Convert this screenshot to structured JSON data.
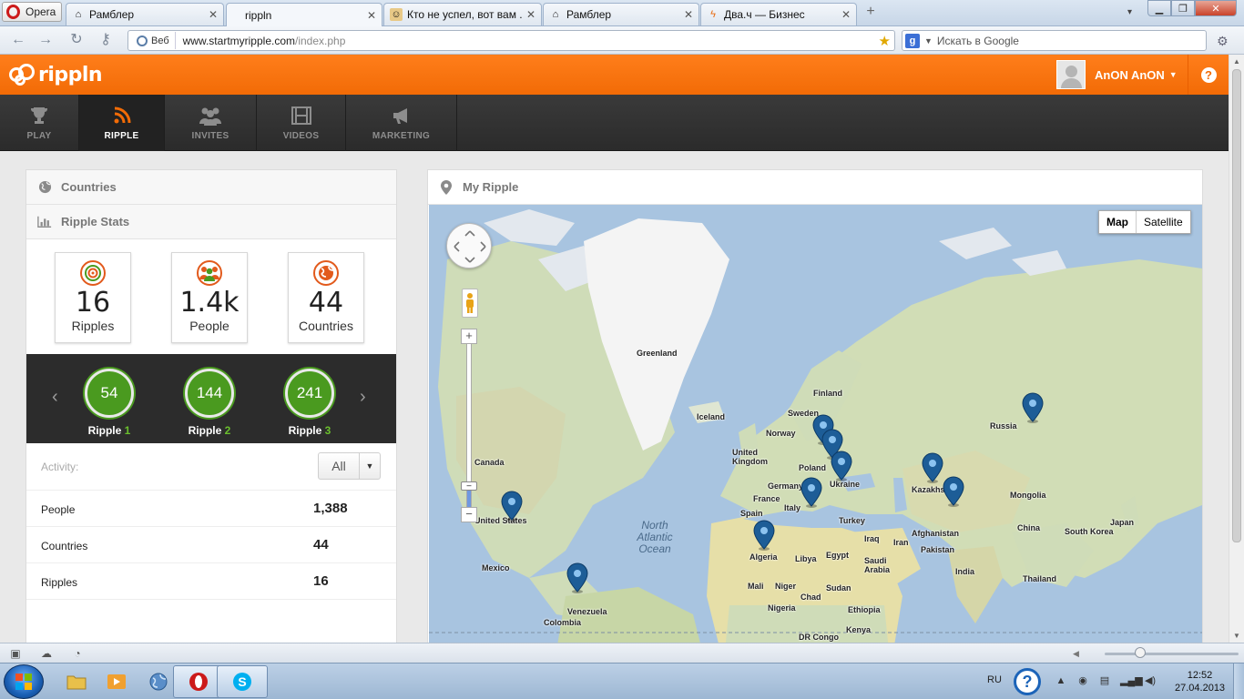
{
  "browser": {
    "menu_label": "Opera",
    "tabs": [
      {
        "label": "Рамблер",
        "fav": "home-icon"
      },
      {
        "label": "rippln",
        "fav": "none",
        "active": true
      },
      {
        "label": "Кто не успел, вот вам ...",
        "fav": "face-icon"
      },
      {
        "label": "Рамблер",
        "fav": "home-icon"
      },
      {
        "label": "Два.ч — Бизнес",
        "fav": "bolt-icon"
      }
    ],
    "url_label": "Веб",
    "url_host": "www.startmyripple.com",
    "url_path": "/index.php",
    "search_placeholder": "Искать в Google",
    "search_engine_letter": "g"
  },
  "app": {
    "brand": "rippln",
    "accent_color": "#f26b06",
    "user_name": "AnON AnON",
    "nav": [
      {
        "label": "PLAY",
        "icon": "trophy-icon"
      },
      {
        "label": "RIPPLE",
        "icon": "rss-icon",
        "active": true
      },
      {
        "label": "INVITES",
        "icon": "people-icon"
      },
      {
        "label": "VIDEOS",
        "icon": "film-icon"
      },
      {
        "label": "MARKETING",
        "icon": "megaphone-icon"
      }
    ]
  },
  "left_panel": {
    "countries_title": "Countries",
    "stats_title": "Ripple Stats",
    "stat_cards": [
      {
        "value": "16",
        "label": "Ripples",
        "icon": "ripple-icon"
      },
      {
        "value": "1.4k",
        "label": "People",
        "icon": "people-icon"
      },
      {
        "value": "44",
        "label": "Countries",
        "icon": "globe-icon"
      }
    ],
    "ripple_levels": [
      {
        "value": "54",
        "label": "Ripple",
        "num": "1"
      },
      {
        "value": "144",
        "label": "Ripple",
        "num": "2"
      },
      {
        "value": "241",
        "label": "Ripple",
        "num": "3"
      }
    ],
    "activity_label": "Activity:",
    "activity_filter": "All",
    "activity_rows": [
      {
        "name": "People",
        "value": "1,388"
      },
      {
        "name": "Countries",
        "value": "44"
      },
      {
        "name": "Ripples",
        "value": "16"
      }
    ]
  },
  "map_panel": {
    "title": "My Ripple",
    "map_type_map": "Map",
    "map_type_satellite": "Satellite",
    "labels": {
      "greenland": "Greenland",
      "iceland": "Iceland",
      "finland": "Finland",
      "sweden": "Sweden",
      "norway": "Norway",
      "russia": "Russia",
      "uk": "United Kingdom",
      "canada": "Canada",
      "germany": "Germany",
      "poland": "Poland",
      "ukraine": "Ukraine",
      "france": "France",
      "italy": "Italy",
      "spain": "Spain",
      "turkey": "Turkey",
      "kazakhstan": "Kazakhstan",
      "mongolia": "Mongolia",
      "china": "China",
      "south_korea": "South Korea",
      "japan": "Japan",
      "united_states": "United States",
      "north_atlantic": "North Atlantic Ocean",
      "mexico": "Mexico",
      "venezuela": "Venezuela",
      "colombia": "Colombia",
      "algeria": "Algeria",
      "libya": "Libya",
      "egypt": "Egypt",
      "iraq": "Iraq",
      "iran": "Iran",
      "afghanistan": "Afghanistan",
      "pakistan": "Pakistan",
      "saudi_arabia": "Saudi Arabia",
      "india": "India",
      "thailand": "Thailand",
      "mali": "Mali",
      "niger": "Niger",
      "chad": "Chad",
      "sudan": "Sudan",
      "nigeria": "Nigeria",
      "ethiopia": "Ethiopia",
      "kenya": "Kenya",
      "dr_congo": "DR Congo"
    }
  },
  "taskbar": {
    "lang": "RU",
    "time": "12:52",
    "date": "27.04.2013"
  }
}
